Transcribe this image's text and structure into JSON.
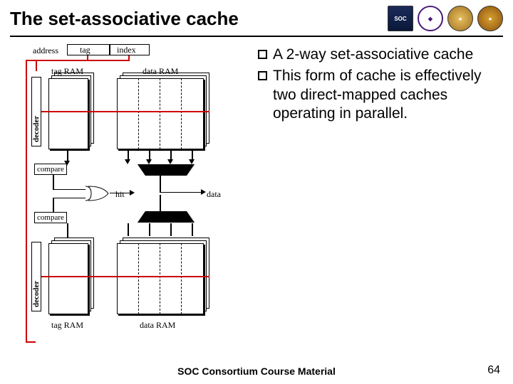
{
  "header": {
    "title": "The set-associative cache",
    "logos": [
      "SOC",
      "◆",
      "●",
      "●"
    ]
  },
  "diagram": {
    "address_label": "address",
    "tag_label": "tag",
    "index_label": "index",
    "tag_ram_label": "tag RAM",
    "data_ram_label": "data RAM",
    "decoder_label": "decoder",
    "compare_label": "compare",
    "mux_label": "mux",
    "hit_label": "hit",
    "data_label": "data"
  },
  "bullets": [
    "A 2-way set-associative cache",
    "This form of cache is effectively two direct-mapped caches operating in parallel."
  ],
  "footer": "SOC Consortium Course Material",
  "page_number": "64"
}
